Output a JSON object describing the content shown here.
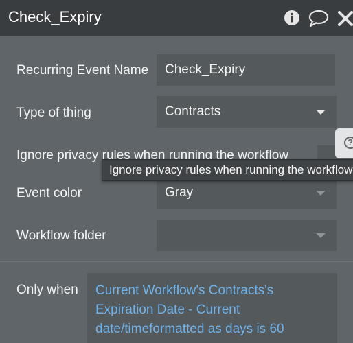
{
  "header": {
    "title": "Check_Expiry"
  },
  "form": {
    "event_name_label": "Recurring Event Name",
    "event_name_value": "Check_Expiry",
    "type_label": "Type of thing",
    "type_value": "Contracts",
    "privacy_label": "Ignore privacy rules when running the workflow",
    "privacy_checked": false,
    "privacy_tooltip": "Ignore privacy rules when running the workflow",
    "color_label": "Event color",
    "color_value": "Gray",
    "folder_label": "Workflow folder",
    "folder_value": "",
    "only_when_label": "Only when",
    "only_when_expression_line1": "Current Workflow's Contracts's",
    "only_when_expression_line2": "Expiration Date - Current",
    "only_when_expression_line3": "date/timeformatted as days is 60"
  },
  "icons": {
    "info": "info-icon",
    "comment": "comment-icon",
    "close": "close-icon",
    "help": "help-icon"
  },
  "colors": {
    "panel_bg": "#5f6568",
    "header_bg": "#3a3d40",
    "field_bg": "#54595c",
    "expression_text": "#6fb3ea"
  }
}
